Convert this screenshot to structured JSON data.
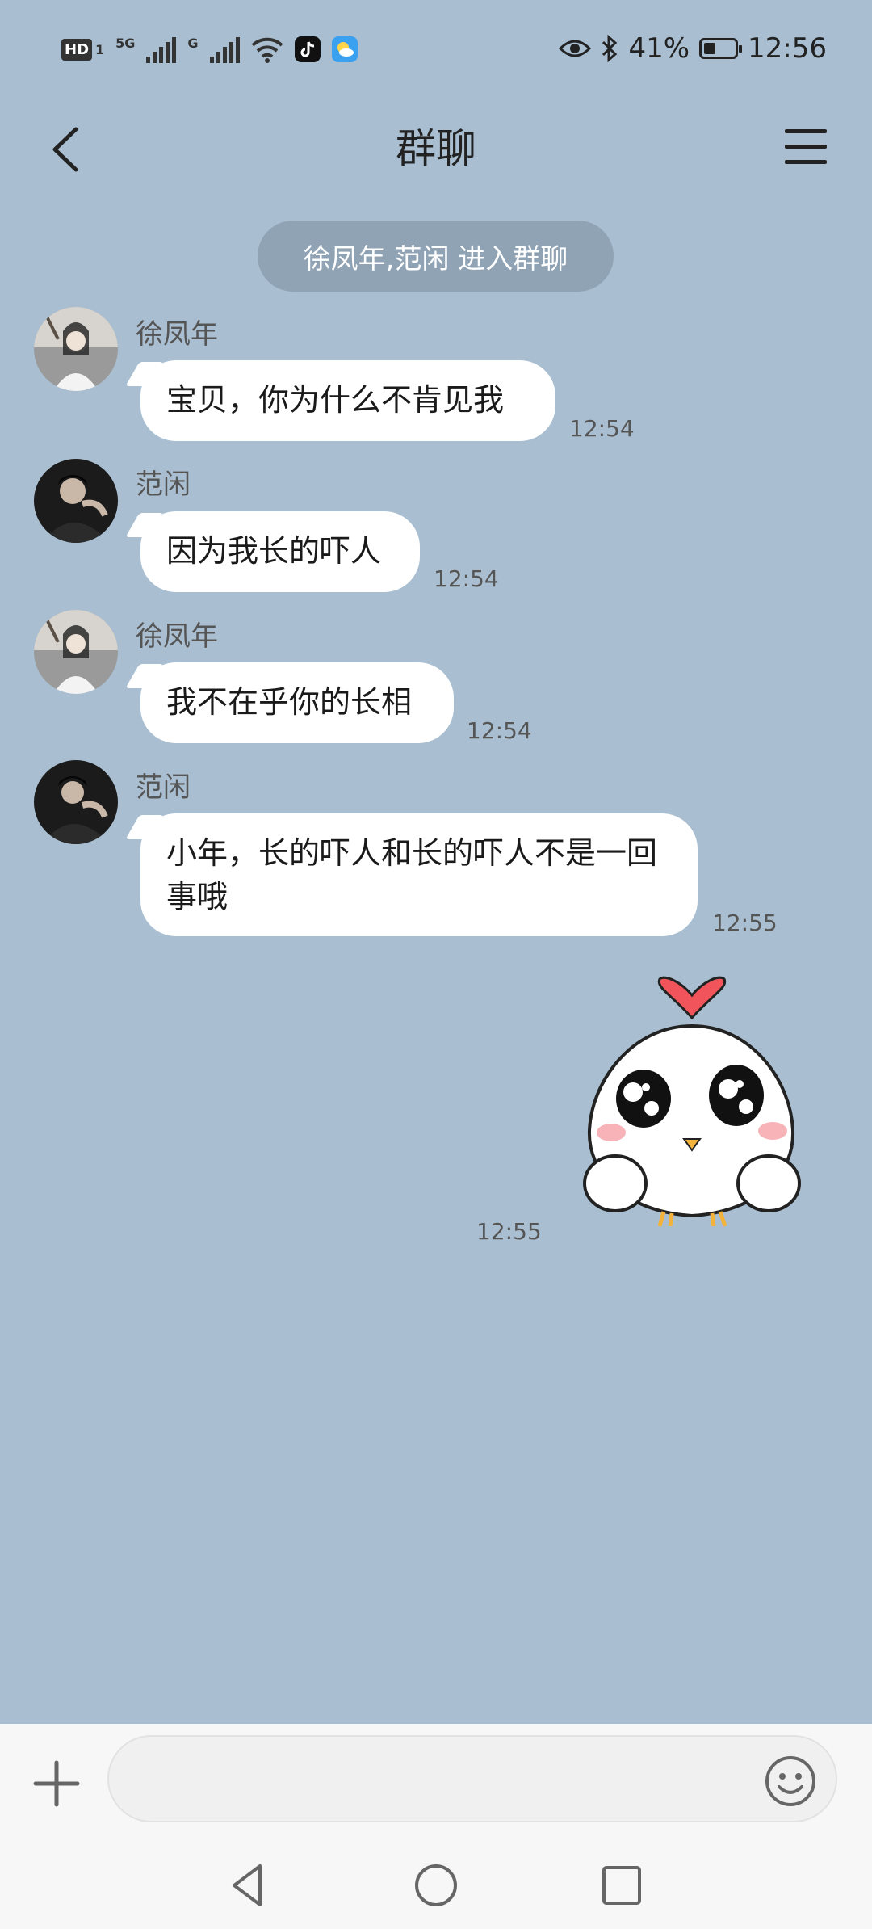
{
  "status_bar": {
    "left_labels": {
      "hd": "HD",
      "net1": "5G",
      "net2": "G"
    },
    "battery_percent": "41%",
    "time": "12:56"
  },
  "header": {
    "title": "群聊"
  },
  "system_notice": "徐凤年,范闲 进入群聊",
  "messages": [
    {
      "sender": "徐凤年",
      "text": "宝贝，你为什么不肯见我",
      "time": "12:54"
    },
    {
      "sender": "范闲",
      "text": "因为我长的吓人",
      "time": "12:54"
    },
    {
      "sender": "徐凤年",
      "text": "我不在乎你的长相",
      "time": "12:54"
    },
    {
      "sender": "范闲",
      "text": "小年，长的吓人和长的吓人不是一回事哦",
      "time": "12:55"
    }
  ],
  "sticker": {
    "time": "12:55"
  },
  "input": {
    "placeholder": ""
  },
  "colors": {
    "background": "#a9bfd1",
    "bubble": "#ffffff",
    "notice": "#8fa3b4"
  }
}
